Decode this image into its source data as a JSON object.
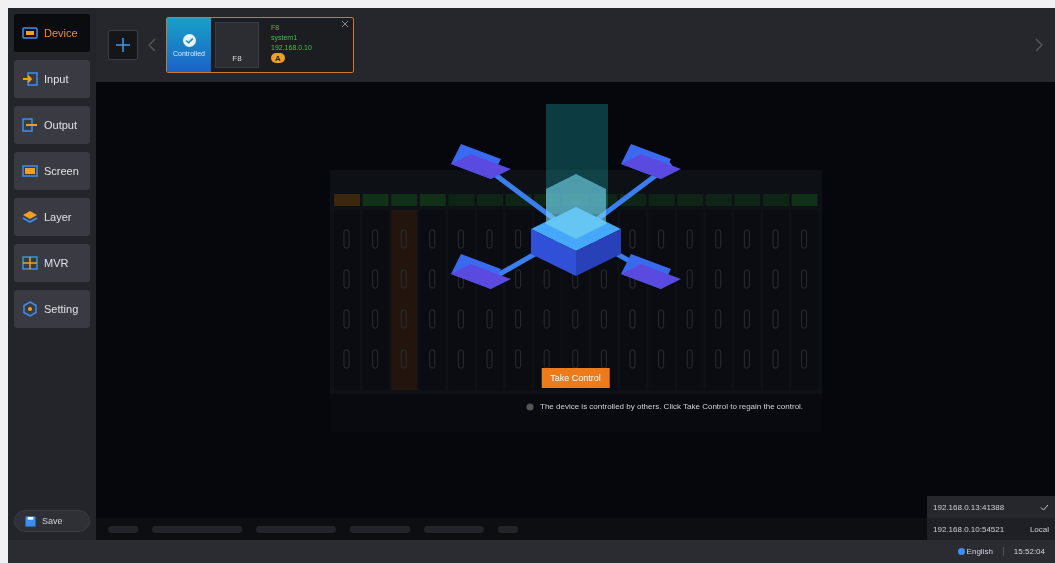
{
  "sidebar": {
    "items": [
      {
        "label": "Device",
        "kind": "device",
        "selected": true
      },
      {
        "label": "Input",
        "kind": "input",
        "selected": false
      },
      {
        "label": "Output",
        "kind": "output",
        "selected": false
      },
      {
        "label": "Screen",
        "kind": "screen",
        "selected": false
      },
      {
        "label": "Layer",
        "kind": "layer",
        "selected": false
      },
      {
        "label": "MVR",
        "kind": "mvr",
        "selected": false
      },
      {
        "label": "Setting",
        "kind": "setting",
        "selected": false
      }
    ],
    "save": "Save"
  },
  "device_card": {
    "status": "Controlled",
    "thumbnail_label": "F8",
    "model": "F8",
    "name": "system1",
    "ip": "192.168.0.10",
    "badge": "A",
    "selected": true
  },
  "overlay": {
    "button": "Take Control",
    "message": "The device is controlled by others. Click Take Control to regain the control."
  },
  "connections": [
    {
      "address": "192.168.0.13:41388",
      "selected": true
    },
    {
      "address": "192.168.0.10:54521",
      "tag": "Local",
      "selected": false
    }
  ],
  "footer": {
    "language": "English",
    "time": "15:52:04"
  }
}
